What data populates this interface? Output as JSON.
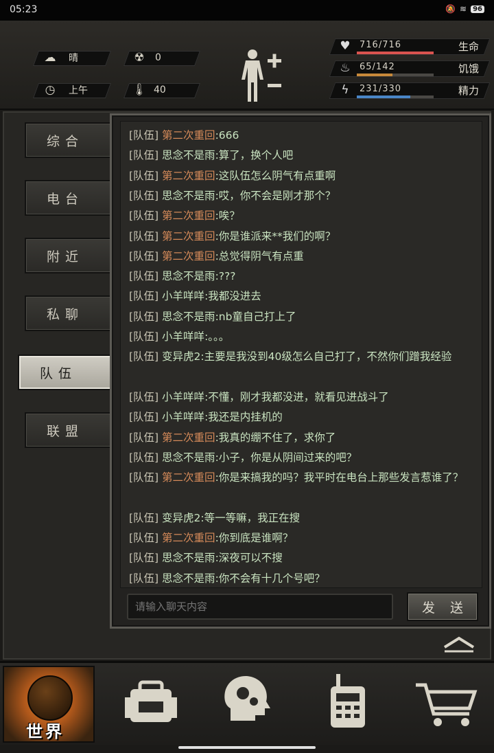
{
  "status_bar": {
    "time": "05:23",
    "battery": "96"
  },
  "header": {
    "weather": {
      "icon": "cloud-sun-icon",
      "value": "晴"
    },
    "radiation": {
      "icon": "radiation-icon",
      "value": "0"
    },
    "time_of_day": {
      "icon": "clock-icon",
      "value": "上午"
    },
    "temperature": {
      "icon": "thermometer-icon",
      "value": "40"
    },
    "stats": [
      {
        "icon": "heart-icon",
        "value": "716/716",
        "label": "生命",
        "fraction": 1.0,
        "color": "#d9534f"
      },
      {
        "icon": "stomach-icon",
        "value": "65/142",
        "label": "饥饿",
        "fraction": 0.46,
        "color": "#c8893a"
      },
      {
        "icon": "energy-icon",
        "value": "231/330",
        "label": "精力",
        "fraction": 0.7,
        "color": "#4a86c7"
      }
    ]
  },
  "tabs": [
    {
      "label": "综合",
      "name": "tab-general"
    },
    {
      "label": "电台",
      "name": "tab-radio"
    },
    {
      "label": "附近",
      "name": "tab-nearby"
    },
    {
      "label": "私聊",
      "name": "tab-private"
    },
    {
      "label": "队伍",
      "name": "tab-team",
      "active": true
    },
    {
      "label": "联盟",
      "name": "tab-alliance"
    }
  ],
  "chat": {
    "messages": [
      {
        "channel": "[队伍]",
        "sender": "第二次重回",
        "sender_color": "orange",
        "text": ":666"
      },
      {
        "channel": "[队伍]",
        "sender": "思念不是雨",
        "sender_color": "green",
        "text": ":算了，换个人吧"
      },
      {
        "channel": "[队伍]",
        "sender": "第二次重回",
        "sender_color": "orange",
        "text": ":这队伍怎么阴气有点重啊"
      },
      {
        "channel": "[队伍]",
        "sender": "思念不是雨",
        "sender_color": "green",
        "text": ":哎，你不会是刚才那个？"
      },
      {
        "channel": "[队伍]",
        "sender": "第二次重回",
        "sender_color": "orange",
        "text": ":唉？"
      },
      {
        "channel": "[队伍]",
        "sender": "第二次重回",
        "sender_color": "orange",
        "text": ":你是谁派来**我们的啊？"
      },
      {
        "channel": "[队伍]",
        "sender": "第二次重回",
        "sender_color": "orange",
        "text": ":总觉得阴气有点重"
      },
      {
        "channel": "[队伍]",
        "sender": "思念不是雨",
        "sender_color": "green",
        "text": ":???"
      },
      {
        "channel": "[队伍]",
        "sender": "小羊咩咩",
        "sender_color": "green",
        "text": ":我都没进去"
      },
      {
        "channel": "[队伍]",
        "sender": "思念不是雨",
        "sender_color": "green",
        "text": ":nb童自己打上了"
      },
      {
        "channel": "[队伍]",
        "sender": "小羊咩咩",
        "sender_color": "green",
        "text": ":。。。"
      },
      {
        "channel": "[队伍]",
        "sender": "变异虎2",
        "sender_color": "green",
        "text": ":主要是我没到40级怎么自己打了，不然你们蹭我经验"
      },
      {
        "channel": "[队伍]",
        "sender": "小羊咩咩",
        "sender_color": "green",
        "text": ":不懂，刚才我都没进，就看见进战斗了"
      },
      {
        "channel": "[队伍]",
        "sender": "小羊咩咩",
        "sender_color": "green",
        "text": ":我还是内挂机的"
      },
      {
        "channel": "[队伍]",
        "sender": "第二次重回",
        "sender_color": "orange",
        "text": ":我真的绷不住了，求你了"
      },
      {
        "channel": "[队伍]",
        "sender": "思念不是雨",
        "sender_color": "green",
        "text": ":小子，你是从阴间过来的吧？"
      },
      {
        "channel": "[队伍]",
        "sender": "第二次重回",
        "sender_color": "orange",
        "text": ":你是来搞我的吗？我平时在电台上那些发言惹谁了？"
      },
      {
        "channel": "[队伍]",
        "sender": "变异虎2",
        "sender_color": "green",
        "text": ":等一等嘛，我正在搜"
      },
      {
        "channel": "[队伍]",
        "sender": "第二次重回",
        "sender_color": "orange",
        "text": ":你到底是谁啊？"
      },
      {
        "channel": "[队伍]",
        "sender": "思念不是雨",
        "sender_color": "green",
        "text": ":深夜可以不搜"
      },
      {
        "channel": "[队伍]",
        "sender": "思念不是雨",
        "sender_color": "green",
        "text": ":你不会有十几个号吧？"
      }
    ],
    "input_placeholder": "请输入聊天内容",
    "send_label": "发 送"
  },
  "bottom_nav": [
    {
      "name": "nav-world",
      "label": "世界",
      "icon": "globe-icon",
      "active": true
    },
    {
      "name": "nav-backpack",
      "icon": "backpack-icon"
    },
    {
      "name": "nav-skills",
      "icon": "head-gears-icon"
    },
    {
      "name": "nav-walkie-talkie",
      "icon": "walkie-talkie-icon"
    },
    {
      "name": "nav-shop",
      "icon": "shopping-cart-icon"
    }
  ]
}
